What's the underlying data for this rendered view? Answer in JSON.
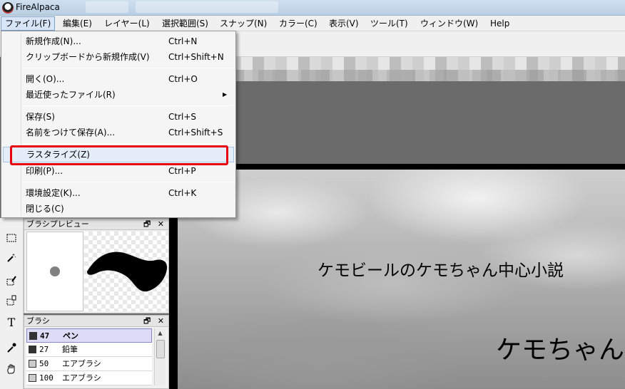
{
  "window": {
    "title": "FireAlpaca"
  },
  "menubar": [
    {
      "label": "ファイル(F)",
      "active": true
    },
    {
      "label": "編集(E)"
    },
    {
      "label": "レイヤー(L)"
    },
    {
      "label": "選択範囲(S)"
    },
    {
      "label": "スナップ(N)"
    },
    {
      "label": "カラー(C)"
    },
    {
      "label": "表示(V)"
    },
    {
      "label": "ツール(T)"
    },
    {
      "label": "ウィンドウ(W)"
    },
    {
      "label": "Help"
    }
  ],
  "file_menu": [
    {
      "label": "新規作成(N)...",
      "shortcut": "Ctrl+N"
    },
    {
      "label": "クリップボードから新規作成(V)",
      "shortcut": "Ctrl+Shift+N"
    },
    {
      "label": "開く(O)...",
      "shortcut": "Ctrl+O"
    },
    {
      "label": "最近使ったファイル(R)",
      "shortcut": "",
      "submenu": true
    },
    {
      "label": "保存(S)",
      "shortcut": "Ctrl+S"
    },
    {
      "label": "名前をつけて保存(A)...",
      "shortcut": "Ctrl+Shift+S"
    },
    {
      "label": "ラスタライズ(Z)",
      "shortcut": "",
      "highlighted": true
    },
    {
      "label": "印刷(P)...",
      "shortcut": "Ctrl+P"
    },
    {
      "label": "環境設定(K)...",
      "shortcut": "Ctrl+K"
    },
    {
      "label": "閉じる(C)",
      "shortcut": ""
    }
  ],
  "brush_preview_panel": {
    "title": "ブラシプレビュー",
    "controls": "🗗 ✕"
  },
  "brush_panel": {
    "title": "ブラシ",
    "controls": "🗗 ✕",
    "items": [
      {
        "size": "47",
        "name": "ペン",
        "selected": true,
        "swatch": "#333333"
      },
      {
        "size": "27",
        "name": "鉛筆",
        "swatch": "#333333"
      },
      {
        "size": "50",
        "name": "エアブラシ",
        "swatch": "#cccccc"
      },
      {
        "size": "100",
        "name": "エアブラシ",
        "swatch": "#cccccc"
      }
    ]
  },
  "canvas": {
    "line1": "ケモビールのケモちゃん中心小説",
    "line2": "ケモちゃん大"
  },
  "colors": {
    "highlight_border": "#e8000a",
    "selected_brush": "#dcdcf6"
  }
}
